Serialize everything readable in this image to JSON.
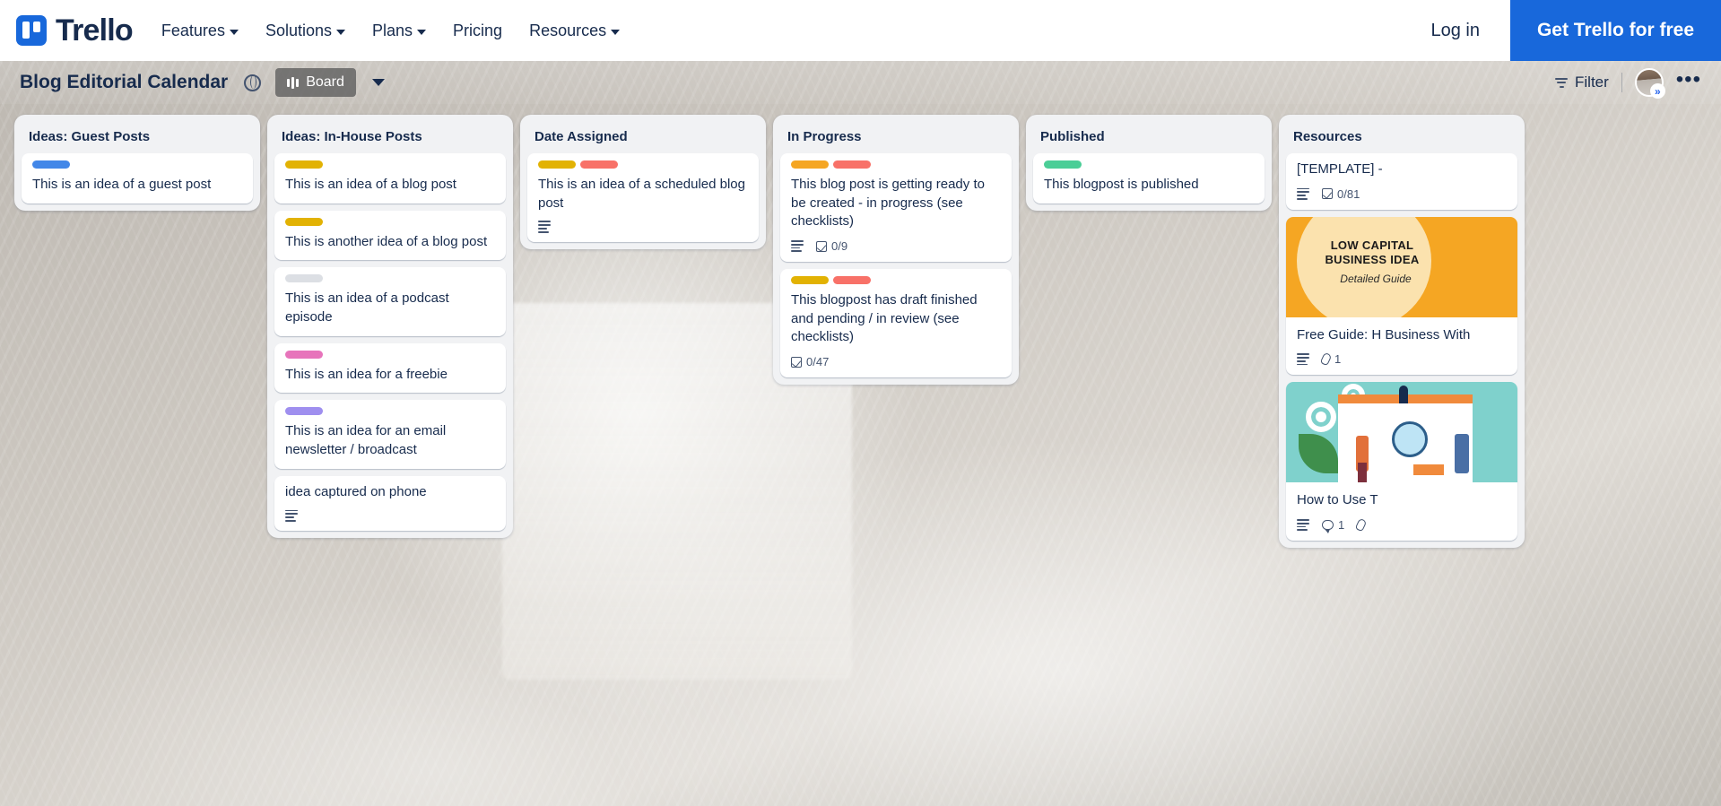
{
  "topnav": {
    "brand": "Trello",
    "links": [
      {
        "label": "Features",
        "has_caret": true
      },
      {
        "label": "Solutions",
        "has_caret": true
      },
      {
        "label": "Plans",
        "has_caret": true
      },
      {
        "label": "Pricing",
        "has_caret": false
      },
      {
        "label": "Resources",
        "has_caret": true
      }
    ],
    "login_label": "Log in",
    "cta_label": "Get Trello for free",
    "cta_color": "#1868DB"
  },
  "boardbar": {
    "title": "Blog Editorial Calendar",
    "visibility_icon": "globe-icon",
    "view_label": "Board",
    "view_icon": "board-icon",
    "chevron_icon": "chevron-down-icon",
    "filter_label": "Filter",
    "filter_icon": "filter-icon",
    "avatar_badge": "»",
    "more_label": "•••"
  },
  "label_colors": {
    "blue": "#4287E8",
    "gold": "#E2B203",
    "yellow": "#E5C100",
    "grey": "#DCDFE4",
    "pink": "#E774BB",
    "purple": "#9F8FEF",
    "orange": "#F5A623",
    "red": "#F87168",
    "green": "#4BCE97"
  },
  "lists": [
    {
      "title": "Ideas: Guest Posts",
      "cards": [
        {
          "title": "This is an idea of a guest post",
          "labels": [
            "blue"
          ],
          "badges": []
        }
      ]
    },
    {
      "title": "Ideas: In-House Posts",
      "cards": [
        {
          "title": "This is an idea of a blog post",
          "labels": [
            "gold"
          ],
          "badges": []
        },
        {
          "title": "This is another idea of a blog post",
          "labels": [
            "gold"
          ],
          "badges": []
        },
        {
          "title": "This is an idea of a podcast episode",
          "labels": [
            "grey"
          ],
          "badges": []
        },
        {
          "title": "This is an idea for a freebie",
          "labels": [
            "pink"
          ],
          "badges": []
        },
        {
          "title": "This is an idea for an email newsletter / broadcast",
          "labels": [
            "purple"
          ],
          "badges": []
        },
        {
          "title": "idea captured on phone",
          "labels": [],
          "badges": [
            {
              "icon": "description-icon",
              "text": ""
            }
          ]
        }
      ]
    },
    {
      "title": "Date Assigned",
      "cards": [
        {
          "title": "This is an idea of a scheduled blog post",
          "labels": [
            "gold",
            "red"
          ],
          "badges": [
            {
              "icon": "description-icon",
              "text": ""
            }
          ]
        }
      ]
    },
    {
      "title": "In Progress",
      "cards": [
        {
          "title": "This blog post is getting ready to be created - in progress (see checklists)",
          "labels": [
            "orange",
            "red"
          ],
          "badges": [
            {
              "icon": "description-icon",
              "text": ""
            },
            {
              "icon": "checklist-icon",
              "text": "0/9"
            }
          ]
        },
        {
          "title": "This blogpost has draft finished and pending / in review (see checklists)",
          "labels": [
            "gold",
            "red"
          ],
          "badges": [
            {
              "icon": "checklist-icon",
              "text": "0/47"
            }
          ]
        }
      ]
    },
    {
      "title": "Published",
      "cards": [
        {
          "title": "This blogpost is published",
          "labels": [
            "green"
          ],
          "badges": []
        }
      ]
    },
    {
      "title": "Resources",
      "cards": [
        {
          "title": "[TEMPLATE] -",
          "labels": [],
          "badges": [
            {
              "icon": "description-icon",
              "text": ""
            },
            {
              "icon": "checklist-icon",
              "text": "0/81"
            }
          ]
        },
        {
          "title": "Free Guide: H Business With",
          "labels": [],
          "cover": "low-capital-business-idea",
          "cover_text_1": "LOW CAPITAL BUSINESS IDEA",
          "cover_text_2": "Detailed Guide",
          "badges": [
            {
              "icon": "description-icon",
              "text": ""
            },
            {
              "icon": "attachment-icon",
              "text": "1"
            }
          ]
        },
        {
          "title": "How to Use T",
          "labels": [],
          "cover": "planning-illustration",
          "badges": [
            {
              "icon": "description-icon",
              "text": ""
            },
            {
              "icon": "comment-icon",
              "text": "1"
            },
            {
              "icon": "attachment-icon",
              "text": ""
            }
          ]
        }
      ]
    }
  ]
}
